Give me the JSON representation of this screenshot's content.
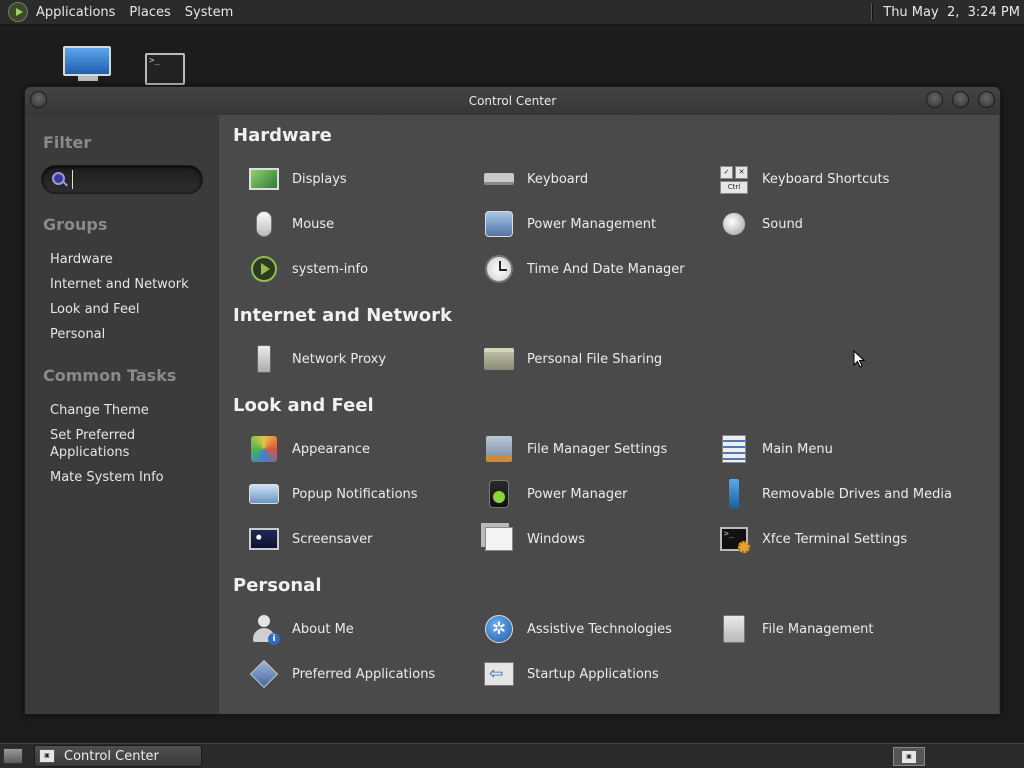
{
  "top_panel": {
    "menus": [
      "Applications",
      "Places",
      "System"
    ],
    "clock": "Thu May  2,  3:24 PM"
  },
  "window": {
    "title": "Control Center"
  },
  "sidebar": {
    "filter_heading": "Filter",
    "search": {
      "value": "",
      "placeholder": ""
    },
    "groups_heading": "Groups",
    "groups": [
      "Hardware",
      "Internet and Network",
      "Look and Feel",
      "Personal"
    ],
    "tasks_heading": "Common Tasks",
    "tasks": [
      "Change Theme",
      "Set Preferred\nApplications",
      "Mate System Info"
    ]
  },
  "categories": [
    {
      "title": "Hardware",
      "items": [
        {
          "label": "Displays",
          "icon": "display-icon"
        },
        {
          "label": "Keyboard",
          "icon": "keyboard-icon"
        },
        {
          "label": "Keyboard Shortcuts",
          "icon": "keyboard-shortcuts-icon"
        },
        {
          "label": "Mouse",
          "icon": "mouse-icon"
        },
        {
          "label": "Power Management",
          "icon": "power-management-icon"
        },
        {
          "label": "Sound",
          "icon": "sound-icon"
        },
        {
          "label": "system-info",
          "icon": "system-info-icon"
        },
        {
          "label": "Time And Date Manager",
          "icon": "clock-icon"
        }
      ]
    },
    {
      "title": "Internet and Network",
      "items": [
        {
          "label": "Network Proxy",
          "icon": "network-proxy-icon"
        },
        {
          "label": "Personal File Sharing",
          "icon": "file-sharing-icon"
        }
      ]
    },
    {
      "title": "Look and Feel",
      "items": [
        {
          "label": "Appearance",
          "icon": "appearance-icon"
        },
        {
          "label": "File Manager Settings",
          "icon": "file-manager-settings-icon"
        },
        {
          "label": "Main Menu",
          "icon": "main-menu-icon"
        },
        {
          "label": "Popup Notifications",
          "icon": "popup-notifications-icon"
        },
        {
          "label": "Power Manager",
          "icon": "power-manager-icon"
        },
        {
          "label": "Removable Drives and Media",
          "icon": "usb-icon"
        },
        {
          "label": "Screensaver",
          "icon": "screensaver-icon"
        },
        {
          "label": "Windows",
          "icon": "windows-icon"
        },
        {
          "label": "Xfce Terminal Settings",
          "icon": "terminal-settings-icon"
        }
      ]
    },
    {
      "title": "Personal",
      "items": [
        {
          "label": "About Me",
          "icon": "about-me-icon"
        },
        {
          "label": "Assistive Technologies",
          "icon": "accessibility-icon"
        },
        {
          "label": "File Management",
          "icon": "file-cabinet-icon"
        },
        {
          "label": "Preferred Applications",
          "icon": "preferred-applications-icon"
        },
        {
          "label": "Startup Applications",
          "icon": "startup-applications-icon"
        }
      ]
    }
  ],
  "taskbar": {
    "task_label": "Control Center"
  }
}
